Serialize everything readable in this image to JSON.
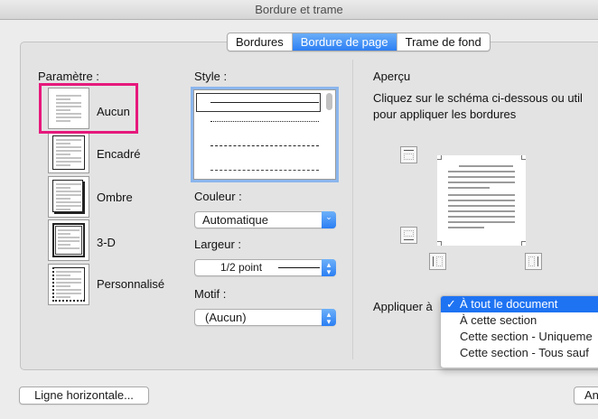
{
  "window": {
    "title": "Bordure et trame"
  },
  "tabs": [
    {
      "label": "Bordures",
      "active": false
    },
    {
      "label": "Bordure de page",
      "active": true
    },
    {
      "label": "Trame de fond",
      "active": false
    }
  ],
  "parametre": {
    "label": "Paramètre :",
    "options": [
      {
        "label": "Aucun",
        "selected": true
      },
      {
        "label": "Encadré"
      },
      {
        "label": "Ombre"
      },
      {
        "label": "3-D"
      },
      {
        "label": "Personnalisé"
      }
    ]
  },
  "style": {
    "label": "Style :"
  },
  "couleur": {
    "label": "Couleur :",
    "value": "Automatique"
  },
  "largeur": {
    "label": "Largeur :",
    "value": "1/2 point"
  },
  "motif": {
    "label": "Motif :",
    "value": "(Aucun)"
  },
  "apercu": {
    "label": "Aperçu",
    "hint_line1": "Cliquez sur le schéma ci-dessous ou util",
    "hint_line2": "pour appliquer les bordures"
  },
  "appliquer": {
    "label": "Appliquer à",
    "options": [
      {
        "label": "À tout le document",
        "selected": true
      },
      {
        "label": "À cette section"
      },
      {
        "label": "Cette section - Uniqueme"
      },
      {
        "label": "Cette section - Tous sauf"
      }
    ]
  },
  "footer": {
    "ligne_horizontale": "Ligne horizontale...",
    "right_button": "An"
  },
  "colors": {
    "accent": "#2d7ff4",
    "highlight": "#e6197c"
  }
}
